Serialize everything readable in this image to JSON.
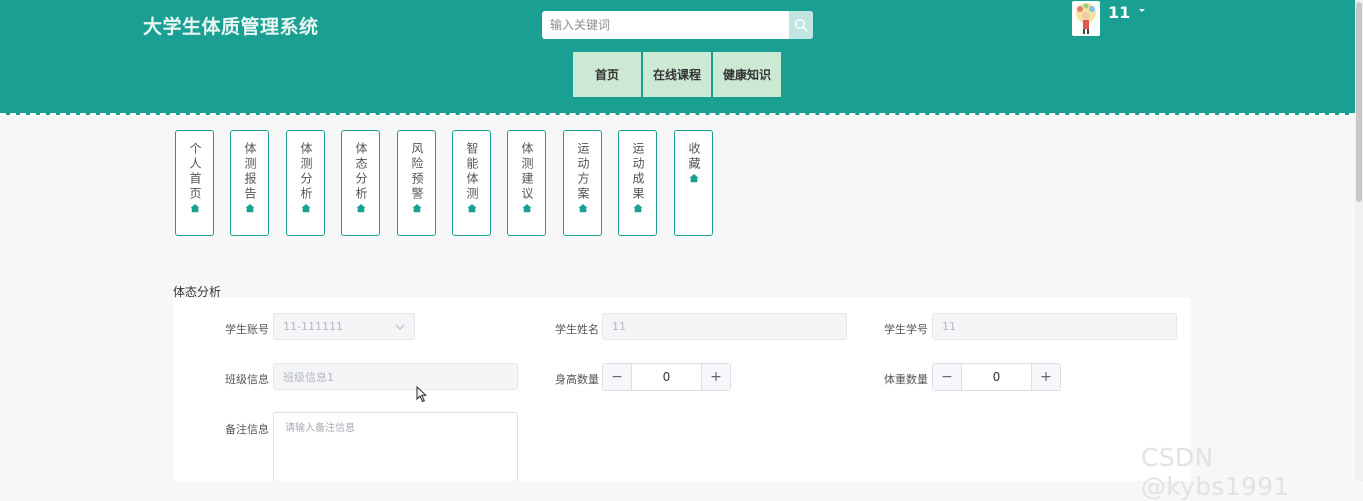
{
  "header": {
    "site_title": "大学生体质管理系统",
    "search": {
      "placeholder": "输入关键词",
      "value": ""
    },
    "user": {
      "name": "11"
    },
    "nav": [
      {
        "label": "首页"
      },
      {
        "label": "在线课程"
      },
      {
        "label": "健康知识"
      }
    ]
  },
  "side_menu": [
    {
      "label": "个人首页",
      "icon": "home-icon"
    },
    {
      "label": "体测报告",
      "icon": "home-icon"
    },
    {
      "label": "体测分析",
      "icon": "home-icon"
    },
    {
      "label": "体态分析",
      "icon": "home-icon"
    },
    {
      "label": "风险预警",
      "icon": "home-icon"
    },
    {
      "label": "智能体测",
      "icon": "home-icon"
    },
    {
      "label": "体测建议",
      "icon": "home-icon"
    },
    {
      "label": "运动方案",
      "icon": "home-icon"
    },
    {
      "label": "运动成果",
      "icon": "home-icon"
    },
    {
      "label": "收藏",
      "icon": "home-icon"
    }
  ],
  "form": {
    "section_title": "体态分析",
    "student_account": {
      "label": "学生账号",
      "value": "11-111111"
    },
    "student_name": {
      "label": "学生姓名",
      "value": "11"
    },
    "student_id": {
      "label": "学生学号",
      "value": "11"
    },
    "class_info": {
      "label": "班级信息",
      "value": "班级信息1"
    },
    "height_count": {
      "label": "身高数量",
      "value": "0",
      "minus": "−",
      "plus": "+"
    },
    "weight_count": {
      "label": "体重数量",
      "value": "0",
      "minus": "−",
      "plus": "+"
    },
    "remarks": {
      "label": "备注信息",
      "placeholder": "请输入备注信息"
    }
  },
  "watermark": "CSDN @kybs1991",
  "colors": {
    "primary": "#1aa092",
    "nav_bg": "#cce9d3",
    "page_bg": "#f7f7f7"
  }
}
